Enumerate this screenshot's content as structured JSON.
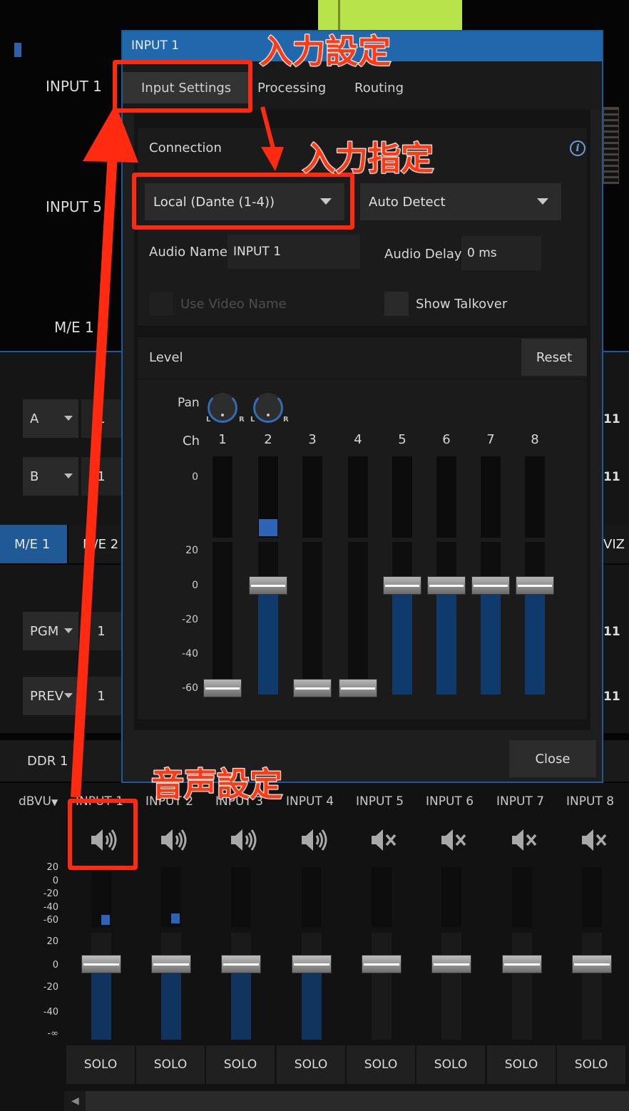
{
  "background": {
    "input_labels": [
      "INPUT 1",
      "INPUT 5",
      "M/E 1"
    ],
    "row_a": {
      "label": "A",
      "value": "1"
    },
    "row_b": {
      "label": "B",
      "value": "1"
    },
    "me_tabs": [
      "M/E 1",
      "M/E 2"
    ],
    "viz_label": "VIZ",
    "pgm": {
      "label": "PGM",
      "value": "1"
    },
    "prev": {
      "label": "PREV",
      "value": "1"
    },
    "right_nums": [
      "11",
      "11",
      "11",
      "11"
    ],
    "ddr_label": "DDR 1"
  },
  "dialog": {
    "title": "INPUT 1",
    "tabs": [
      "Input Settings",
      "Processing",
      "Routing"
    ],
    "connection": {
      "heading": "Connection",
      "source": "Local (Dante (1-4))",
      "detect": "Auto Detect",
      "audio_name_label": "Audio Name",
      "audio_name_value": "INPUT 1",
      "audio_delay_label": "Audio Delay",
      "audio_delay_value": "0 ms",
      "use_video_name": "Use Video Name",
      "show_talkover": "Show Talkover"
    },
    "level": {
      "heading": "Level",
      "reset": "Reset",
      "pan_label": "Pan",
      "pan_lr": [
        "L",
        "R",
        "L",
        "R"
      ],
      "ch_label": "Ch",
      "channels": [
        "1",
        "2",
        "3",
        "4",
        "5",
        "6",
        "7",
        "8"
      ],
      "meter_scale": [
        "0"
      ],
      "fader_scale": [
        "20",
        "0",
        "-20",
        "-40",
        "-60"
      ],
      "fader_levels": [
        "-60",
        "0",
        "-60",
        "-60",
        "0",
        "0",
        "0",
        "0"
      ]
    },
    "close": "Close"
  },
  "mixer": {
    "unit": "dBVU",
    "channels": [
      "INPUT 1",
      "INPUT 2",
      "INPUT 3",
      "INPUT 4",
      "INPUT 5",
      "INPUT 6",
      "INPUT 7",
      "INPUT 8"
    ],
    "muted": [
      false,
      false,
      false,
      false,
      true,
      true,
      true,
      true
    ],
    "meter_scale": [
      "20",
      "0",
      "-20",
      "-40",
      "-60"
    ],
    "fader_scale": [
      "20",
      "0",
      "-20",
      "-40",
      "-∞"
    ],
    "solo": "SOLO"
  },
  "annotations": {
    "input_settings": "入力設定",
    "input_select": "入力指定",
    "audio_settings": "音声設定",
    "color": "#ff2a10"
  }
}
